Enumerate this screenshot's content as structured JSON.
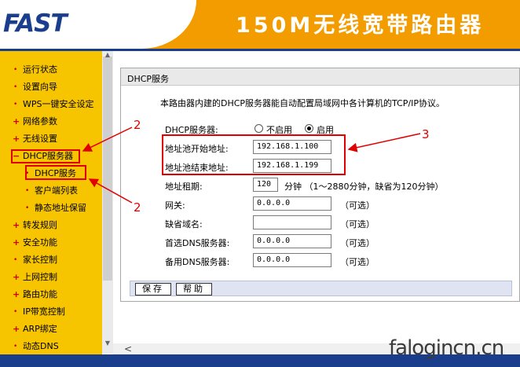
{
  "header": {
    "logo": "FAST",
    "title": "150M无线宽带路由器"
  },
  "sidebar": {
    "items": [
      {
        "label": "运行状态",
        "marker": "•"
      },
      {
        "label": "设置向导",
        "marker": "•"
      },
      {
        "label": "WPS一键安全设定",
        "marker": "•"
      },
      {
        "label": "网络参数",
        "marker": "+"
      },
      {
        "label": "无线设置",
        "marker": "+"
      },
      {
        "label": "DHCP服务器",
        "marker": "−"
      },
      {
        "label": "DHCP服务",
        "marker": "•"
      },
      {
        "label": "客户端列表",
        "marker": "•"
      },
      {
        "label": "静态地址保留",
        "marker": "•"
      },
      {
        "label": "转发规则",
        "marker": "+"
      },
      {
        "label": "安全功能",
        "marker": "+"
      },
      {
        "label": "家长控制",
        "marker": "•"
      },
      {
        "label": "上网控制",
        "marker": "+"
      },
      {
        "label": "路由功能",
        "marker": "+"
      },
      {
        "label": "IP带宽控制",
        "marker": "•"
      },
      {
        "label": "ARP绑定",
        "marker": "+"
      },
      {
        "label": "动态DNS",
        "marker": "•"
      }
    ]
  },
  "panel": {
    "title": "DHCP服务",
    "description": "本路由器内建的DHCP服务器能自动配置局域网中各计算机的TCP/IP协议。",
    "dhcp_server_label": "DHCP服务器:",
    "radio_disable": "不启用",
    "radio_enable": "启用",
    "start_label": "地址池开始地址:",
    "start_value": "192.168.1.100",
    "end_label": "地址池结束地址:",
    "end_value": "192.168.1.199",
    "lease_label": "地址租期:",
    "lease_value": "120",
    "lease_hint": "分钟 （1～2880分钟，缺省为120分钟）",
    "gateway_label": "网关:",
    "gateway_value": "0.0.0.0",
    "domain_label": "缺省域名:",
    "domain_value": "",
    "dns1_label": "首选DNS服务器:",
    "dns1_value": "0.0.0.0",
    "dns2_label": "备用DNS服务器:",
    "dns2_value": "0.0.0.0",
    "optional": "（可选）",
    "save_button": "保存",
    "help_button": "帮助"
  },
  "annotations": {
    "num_2a": "2",
    "num_2b": "2",
    "num_3": "3",
    "color": "#e00000"
  },
  "watermark": "falogincn.cn",
  "colors": {
    "header_orange": "#f39c00",
    "logo_blue": "#1a3e8c",
    "sidebar_yellow": "#f7c400"
  }
}
